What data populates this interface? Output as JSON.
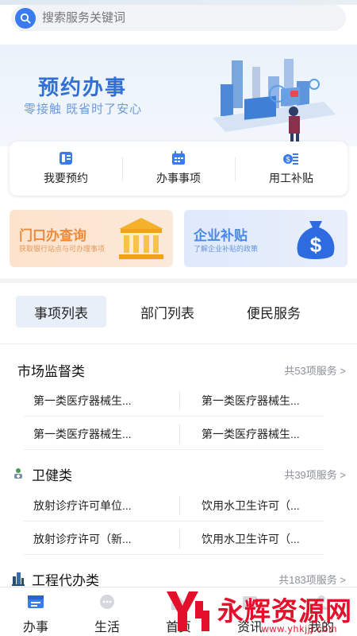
{
  "search": {
    "placeholder": "搜索服务关键词"
  },
  "banner": {
    "title": "预约办事",
    "subtitle": "零接触  既省时了安心"
  },
  "quick_actions": [
    {
      "label": "我要预约",
      "icon": "phone-icon"
    },
    {
      "label": "办事事项",
      "icon": "calendar-icon"
    },
    {
      "label": "用工补贴",
      "icon": "money-icon"
    }
  ],
  "promos": [
    {
      "title": "门口办查询",
      "subtitle": "获取银行站点与可办理事项",
      "icon": "bank-icon"
    },
    {
      "title": "企业补贴",
      "subtitle": "了解企业补贴的政策",
      "icon": "money-bag-icon"
    }
  ],
  "tabs": [
    {
      "label": "事项列表",
      "active": true
    },
    {
      "label": "部门列表",
      "active": false
    },
    {
      "label": "便民服务",
      "active": false
    }
  ],
  "categories": [
    {
      "title": "市场监督类",
      "count": "共53项服务 >",
      "rows": [
        [
          "第一类医疗器械生...",
          "第一类医疗器械生..."
        ],
        [
          "第一类医疗器械生...",
          "第一类医疗器械生..."
        ]
      ]
    },
    {
      "title": "卫健类",
      "count": "共39项服务 >",
      "rows": [
        [
          "放射诊疗许可单位...",
          "饮用水卫生许可（..."
        ],
        [
          "放射诊疗许可（新...",
          "饮用水卫生许可（..."
        ]
      ]
    },
    {
      "title": "工程代办类",
      "count": "共183项服务 >",
      "rows": []
    }
  ],
  "bottom_nav": [
    {
      "label": "办事",
      "active": true
    },
    {
      "label": "生活",
      "active": false
    },
    {
      "label": "首页",
      "active": false
    },
    {
      "label": "资讯",
      "active": false
    },
    {
      "label": "我的",
      "active": false
    }
  ],
  "watermark": {
    "text": "永辉资源网",
    "url": "www.yhkjjj.com"
  },
  "colors": {
    "brand_blue": "#3a7cf0",
    "watermark_red": "#e4102b",
    "promo_orange": "#ef8a3a"
  }
}
